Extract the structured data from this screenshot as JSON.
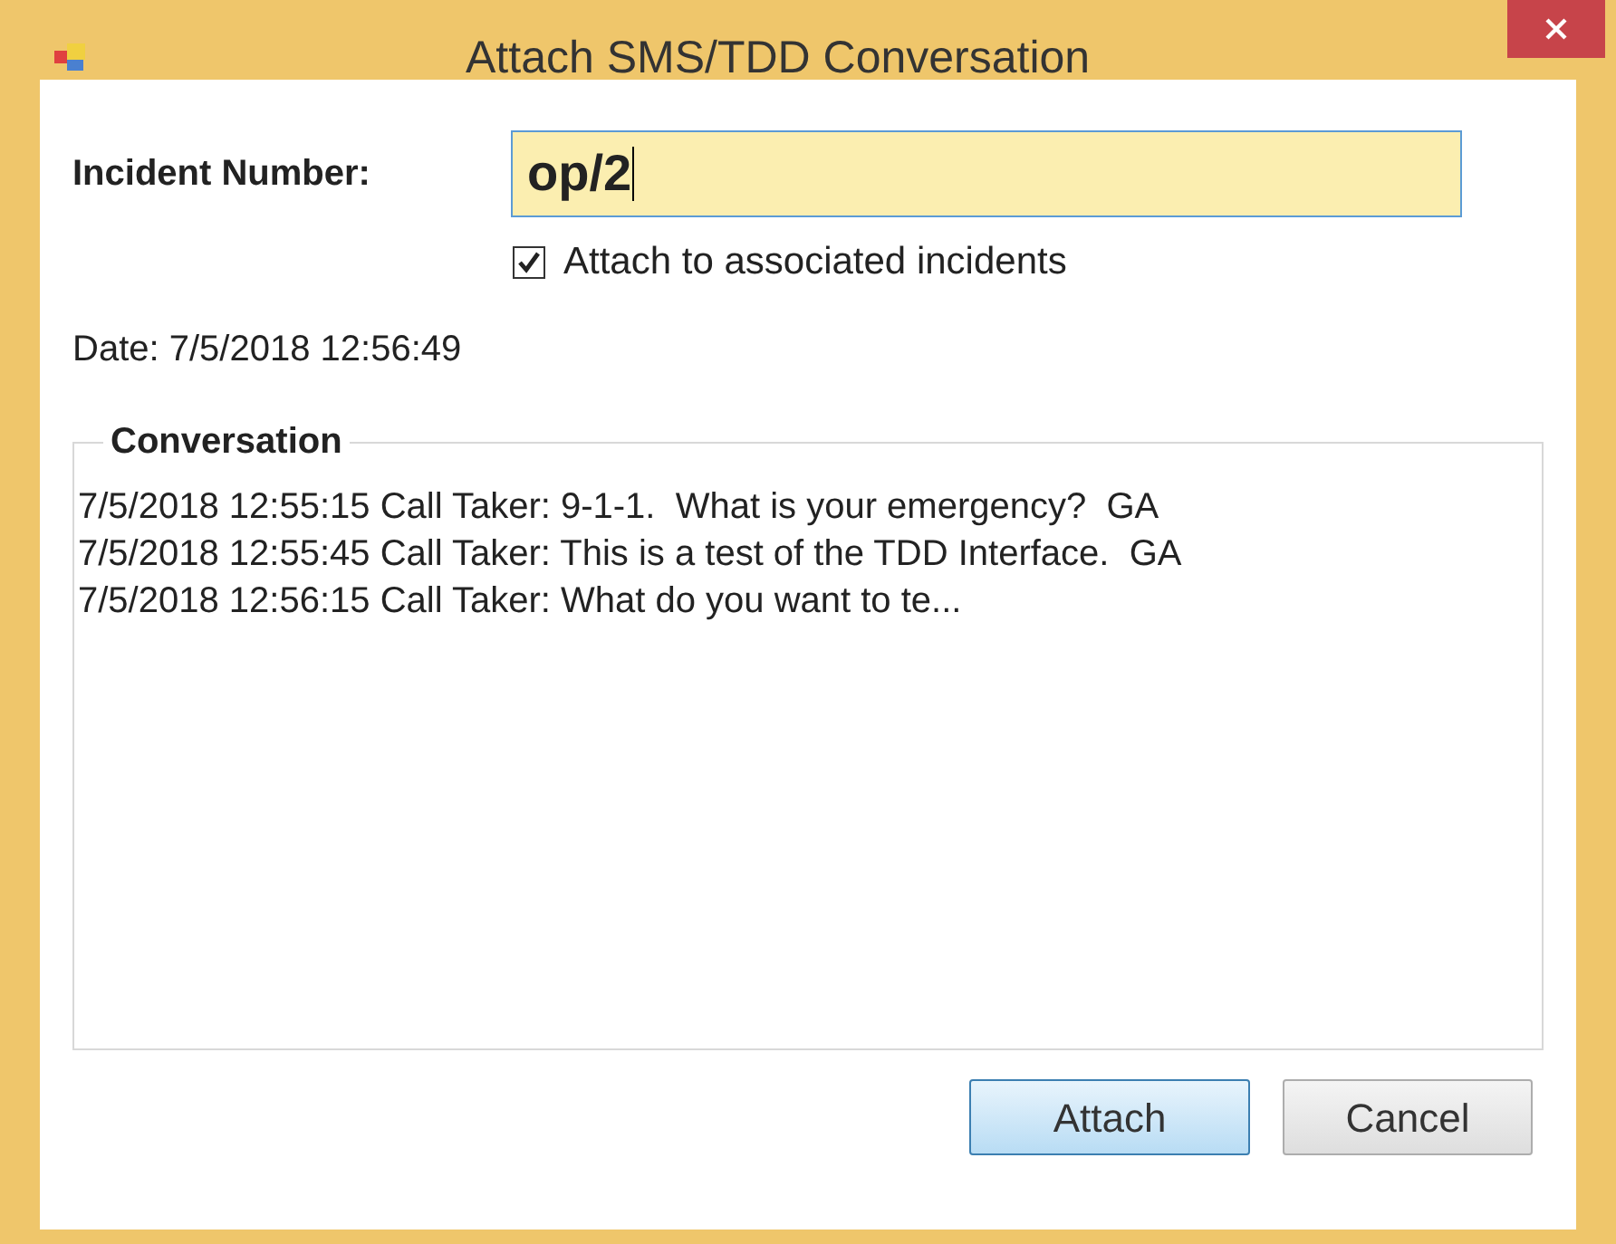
{
  "window": {
    "title": "Attach SMS/TDD Conversation"
  },
  "incident": {
    "label": "Incident Number:",
    "value": "op/2",
    "focused": true
  },
  "attach_associated": {
    "label": "Attach to associated incidents",
    "checked": true
  },
  "date": "Date: 7/5/2018 12:56:49",
  "conversation": {
    "title": "Conversation",
    "lines": [
      "7/5/2018 12:55:15 Call Taker: 9-1-1.  What is your emergency?  GA",
      "7/5/2018 12:55:45 Call Taker: This is a test of the TDD Interface.  GA",
      "7/5/2018 12:56:15 Call Taker: What do you want to te..."
    ]
  },
  "buttons": [
    {
      "label": "Attach",
      "default": true
    },
    {
      "label": "Cancel",
      "default": false
    }
  ]
}
